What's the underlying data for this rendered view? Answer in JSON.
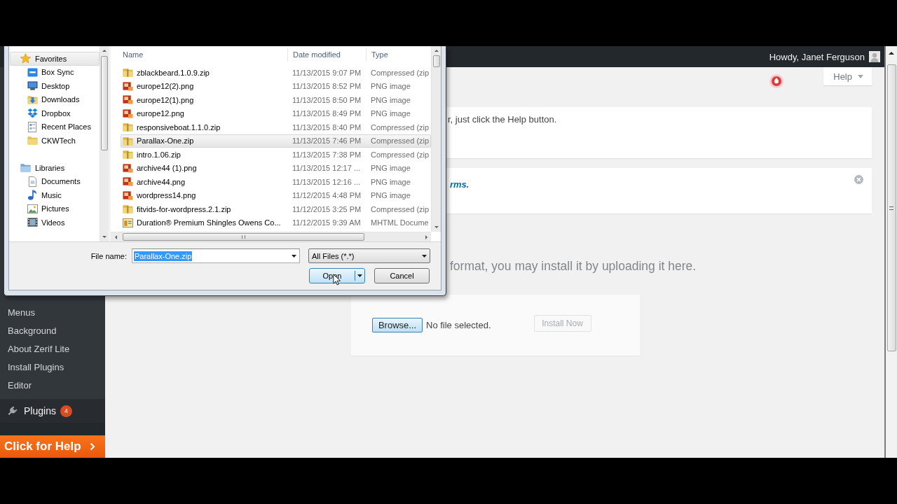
{
  "admin_bar": {
    "greeting": "Howdy, Janet Ferguson"
  },
  "file_dialog": {
    "nav": [
      {
        "label": "Favorites",
        "kind": "star",
        "selected": true,
        "children": [
          {
            "label": "Box Sync",
            "kind": "sync",
            "selected": false
          },
          {
            "label": "Desktop",
            "kind": "desktop",
            "selected": false
          },
          {
            "label": "Downloads",
            "kind": "downloads",
            "selected": false
          },
          {
            "label": "Dropbox",
            "kind": "openbox",
            "selected": false
          },
          {
            "label": "Recent Places",
            "kind": "recent",
            "selected": false
          },
          {
            "label": "CKWTech",
            "kind": "folder",
            "selected": false
          }
        ]
      },
      {
        "label": "Libraries",
        "kind": "libraries",
        "selected": false,
        "children": [
          {
            "label": "Documents",
            "kind": "documents",
            "selected": false
          },
          {
            "label": "Music",
            "kind": "music",
            "selected": false
          },
          {
            "label": "Pictures",
            "kind": "pictures",
            "selected": false
          },
          {
            "label": "Videos",
            "kind": "videos",
            "selected": false
          }
        ]
      }
    ],
    "columns": [
      "Name",
      "Date modified",
      "Type"
    ],
    "files": [
      {
        "name": "zblackbeard.1.0.9.zip",
        "date": "11/13/2015 9:07 PM",
        "type": "Compressed (zip",
        "kind": "archive",
        "selected": false
      },
      {
        "name": "europe12(2).png",
        "date": "11/13/2015 8:52 PM",
        "type": "PNG image",
        "kind": "image",
        "selected": false
      },
      {
        "name": "europe12(1).png",
        "date": "11/13/2015 8:50 PM",
        "type": "PNG image",
        "kind": "image",
        "selected": false
      },
      {
        "name": "europe12.png",
        "date": "11/13/2015 8:49 PM",
        "type": "PNG image",
        "kind": "image",
        "selected": false
      },
      {
        "name": "responsiveboat.1.1.0.zip",
        "date": "11/13/2015 8:40 PM",
        "type": "Compressed (zip",
        "kind": "archive",
        "selected": false
      },
      {
        "name": "Parallax-One.zip",
        "date": "11/13/2015 7:46 PM",
        "type": "Compressed (zip",
        "kind": "archive",
        "selected": true
      },
      {
        "name": "intro.1.06.zip",
        "date": "11/13/2015 7:38 PM",
        "type": "Compressed (zip",
        "kind": "archive",
        "selected": false
      },
      {
        "name": "archive44 (1).png",
        "date": "11/13/2015 12:17 ...",
        "type": "PNG image",
        "kind": "image",
        "selected": false
      },
      {
        "name": "archive44.png",
        "date": "11/13/2015 12:16 ...",
        "type": "PNG image",
        "kind": "image",
        "selected": false
      },
      {
        "name": "wordpress14.png",
        "date": "11/12/2015 4:48 PM",
        "type": "PNG image",
        "kind": "image",
        "selected": false
      },
      {
        "name": "fitvids-for-wordpress.2.1.zip",
        "date": "11/12/2015 3:25 PM",
        "type": "Compressed (zip",
        "kind": "archive",
        "selected": false
      },
      {
        "name": "Duration® Premium Shingles Owens Co...",
        "date": "11/12/2015 9:39 AM",
        "type": "MHTML Docume",
        "kind": "web",
        "selected": false
      }
    ],
    "file_name": {
      "label": "File name:",
      "value": "Parallax-One.zip",
      "value_selected": true
    },
    "filter": "All Files (*.*)",
    "buttons": [
      {
        "label": "Open",
        "kind": "split",
        "focused": true
      },
      {
        "label": "Cancel",
        "kind": "plain",
        "focused": false
      }
    ]
  },
  "help_tab": {
    "label": "Help"
  },
  "notices": [
    {
      "kind": "text",
      "text": "r, just click the Help button.",
      "dismissible": false
    },
    {
      "kind": "link",
      "text": "rms.",
      "dismissible": true
    }
  ],
  "upload": {
    "intro": "format, you may install it by uploading it here.",
    "browse": {
      "label": "Browse...",
      "focused": true
    },
    "status": "No file selected.",
    "install": {
      "label": "Install Now",
      "disabled": true
    }
  },
  "sidebar": {
    "items": [
      {
        "label": "Menus",
        "kind": "sub"
      },
      {
        "label": "Background",
        "kind": "sub"
      },
      {
        "label": "About Zerif Lite",
        "kind": "sub"
      },
      {
        "label": "Install Plugins",
        "kind": "sub"
      },
      {
        "label": "Editor",
        "kind": "sub"
      },
      {
        "label": "Plugins",
        "kind": "plugins",
        "badge": "4"
      }
    ]
  },
  "help_button": {
    "label": "Click for Help"
  }
}
